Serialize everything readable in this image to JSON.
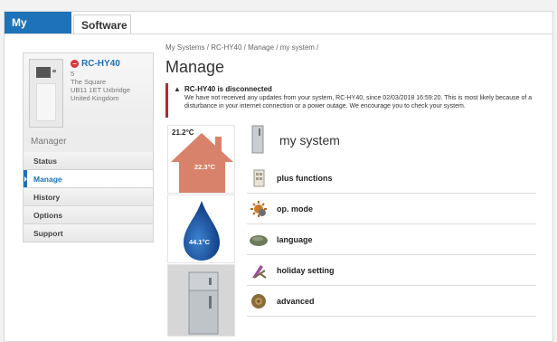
{
  "tabs": [
    {
      "label": "My Systems",
      "active": true
    },
    {
      "label": "Software",
      "active": false
    }
  ],
  "device": {
    "name": "RC-HY40",
    "status_icon": "stop-icon",
    "address": [
      "5",
      "The Square",
      "UB11 1ET Uxbridge",
      "United Kingdom"
    ]
  },
  "sidebar": {
    "section_label": "Manager",
    "items": [
      {
        "label": "Status",
        "active": false
      },
      {
        "label": "Manage",
        "active": true
      },
      {
        "label": "History",
        "active": false
      },
      {
        "label": "Options",
        "active": false
      },
      {
        "label": "Support",
        "active": false
      }
    ]
  },
  "breadcrumb": "My Systems / RC-HY40 / Manage / my system /",
  "page_title": "Manage",
  "alert": {
    "title": "RC-HY40 is disconnected",
    "message": "We have not received any updates from your system, RC-HY40, since 02/03/2018 16:59:20. This is most likely because of a disturbance in your internet connection or a power outage. We encourage you to check your system."
  },
  "tiles": {
    "outdoor_temp": "21.2°C",
    "house_temp": "22.3°C",
    "water_temp": "44.1°C"
  },
  "system": {
    "title": "my system",
    "functions": [
      {
        "label": "plus functions",
        "icon": "panel-icon"
      },
      {
        "label": "op. mode",
        "icon": "sun-gear-icon"
      },
      {
        "label": "language",
        "icon": "speech-stone-icon"
      },
      {
        "label": "holiday setting",
        "icon": "deck-chair-icon"
      },
      {
        "label": "advanced",
        "icon": "gear-stone-icon"
      }
    ]
  },
  "colors": {
    "accent": "#1d72b8",
    "alert": "#b7272a",
    "house": "#d9826b",
    "water": "#1e5aa6"
  }
}
